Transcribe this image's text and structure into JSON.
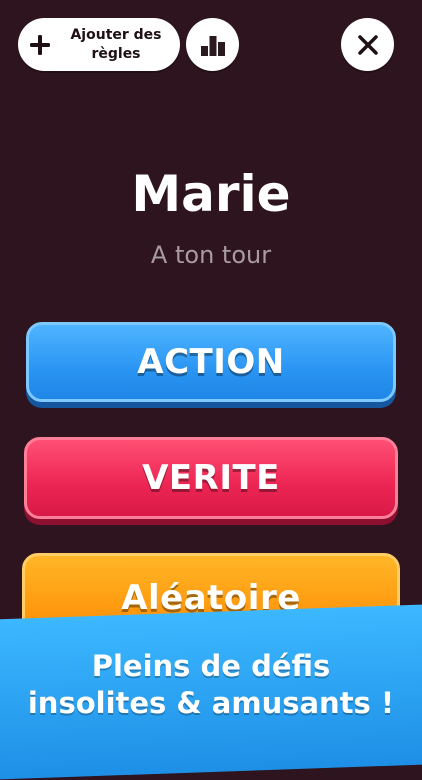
{
  "toolbar": {
    "add_rules_label": "Ajouter des règles",
    "stats_icon": "bar-chart-icon",
    "close_icon": "close-icon"
  },
  "player": {
    "name": "Marie",
    "turn_text": "A ton tour"
  },
  "choices": {
    "action_label": "ACTION",
    "truth_label": "VERITE",
    "random_label": "Aléatoire"
  },
  "promo": {
    "line1": "Pleins de défis",
    "line2": "insolites & amusants !"
  },
  "colors": {
    "background": "#2e141e",
    "action": "#2a95f3",
    "truth": "#ec2553",
    "random": "#ff9b10",
    "promo_band": "#3cb8ff"
  }
}
